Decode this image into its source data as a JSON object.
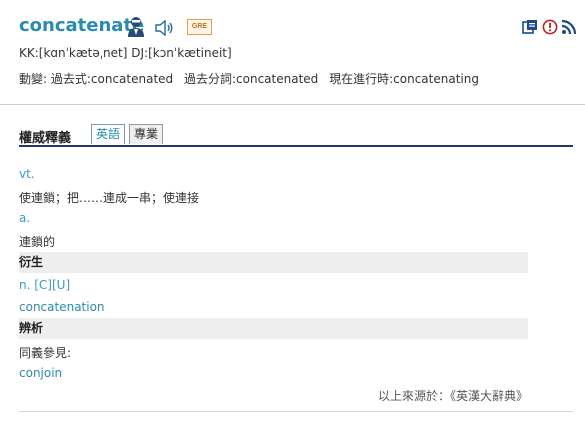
{
  "entry": {
    "word": "concatenate",
    "badge": "GRE",
    "pronunciation": "KK:[kɑnˈkætəˌnet] DJ:[kɔnˈkætineit]",
    "morphology": [
      "動變: 過去式:concatenated",
      "過去分詞:concatenated",
      "現在進行時:concatenating"
    ],
    "icons": {
      "person": "person-icon",
      "speaker": "speaker-icon",
      "toolbar": [
        "copy-icon",
        "report-icon",
        "rss-icon"
      ]
    }
  },
  "tabs": {
    "title": "權威釋義",
    "items": [
      "英語",
      "專業"
    ],
    "active": "英語"
  },
  "definitions": {
    "pos1": "vt.",
    "def1": "使連鎖；把……連成一串；使連接",
    "pos2": "a.",
    "def2": "連鎖的",
    "derivative_heading": "衍生",
    "derivative_pos": "n. [C][U]",
    "derivative_word": "concatenation",
    "analysis_heading": "辨析",
    "synonym_label": "同義參見:",
    "synonym_word": "conjoin",
    "source": "以上來源於：《英漢大辭典》"
  },
  "colors": {
    "accent": "#2a8bb0",
    "tab_underline": "#263a60",
    "section_bg": "#eeeeee",
    "badge_border": "#e0a050"
  }
}
